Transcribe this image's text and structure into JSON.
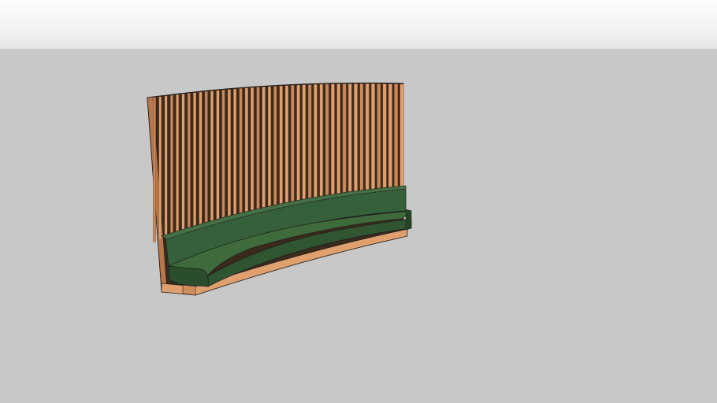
{
  "scene": {
    "kind": "3d-model-viewport",
    "subject": "curved-banquette-with-slatted-wood-wall",
    "colors": {
      "sky_top": "#fdfdfd",
      "sky_bottom": "#e4e6e8",
      "ground": "#c8c8c8",
      "wood_light": "#e0a06e",
      "wood_mid": "#c9875a",
      "wood_dark": "#6e4a2e",
      "slat_gap": "#3b2a1c",
      "upholstery_top": "#3f6a3c",
      "upholstery_face": "#2f5630",
      "upholstery_dark": "#234424",
      "edge": "#1f1f1f"
    }
  }
}
